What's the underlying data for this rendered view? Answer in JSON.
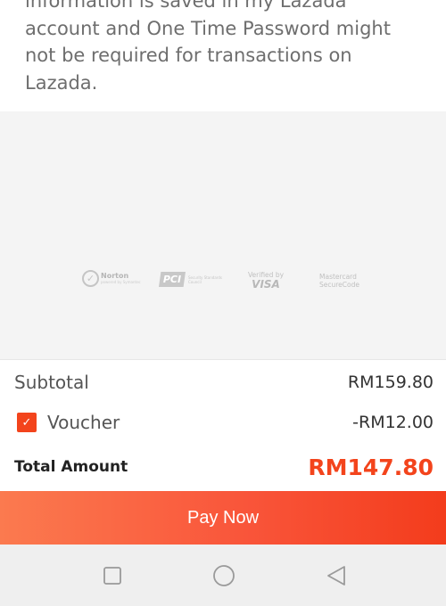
{
  "info_card": {
    "text": "information is saved in my Lazada account and One Time Password might not be required for transactions on Lazada."
  },
  "trust_badges": {
    "norton_name": "Norton",
    "norton_sub": "powered by Symantec",
    "pci_logo": "PCI",
    "pci_sub": "Security Standards Council",
    "visa_line1": "Verified by",
    "visa_line2": "VISA",
    "mastercard_line1": "Mastercard",
    "mastercard_line2": "SecureCode"
  },
  "summary": {
    "subtotal_label": "Subtotal",
    "subtotal_value": "RM159.80",
    "voucher_label": "Voucher",
    "voucher_value": "-RM12.00",
    "voucher_checked": true,
    "total_label": "Total Amount",
    "total_value": "RM147.80"
  },
  "pay_button": {
    "label": "Pay Now"
  },
  "colors": {
    "accent": "#f3441c",
    "pay_gradient_start": "#fb7a4f",
    "pay_gradient_end": "#f33c1c"
  },
  "navbar": {
    "icons": [
      "recents-square-icon",
      "home-circle-icon",
      "back-triangle-icon"
    ]
  }
}
